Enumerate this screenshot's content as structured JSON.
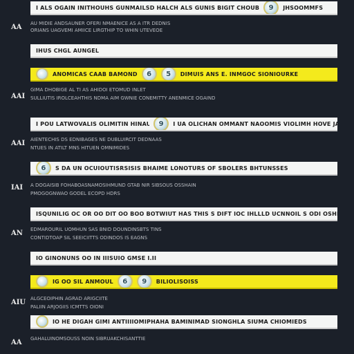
{
  "rows": [
    {
      "bar": "I ALS OGAIN INITHOUHS GUNMAILSD HALCH ALS GUNIS BIGIT CHOUB",
      "badge": "9",
      "bar_tail": "JHSOOMMFS",
      "label": "AA",
      "desc_a": "AU MIDIE ANDSAUNER OFERI NMAENICE AS A ITR DEDNIS",
      "desc_b": "ORIANS UAGVEMI AMIICE LIRGTHIP TO WHIN UTEVEOE"
    },
    {
      "bar": "IHUS CHGL AUNGEL",
      "label": "",
      "desc_a": "",
      "desc_b": ""
    },
    {
      "bar": "ANOMICAS CAAB BAMOND",
      "badge": "6",
      "badge2": "5",
      "bar_tail": "DIMUIS ANS E. INMGOC SIONIOURKE",
      "label": "AAI",
      "desc_a": "GIMA DHOBIGE AL TI AS AHIDOI ETOMUD INLET",
      "desc_b": "SULLIUTIS IROLCEAHTHIS NDMA AIM GWNIE CONEMITTY ANENMICE OGAIND"
    },
    {
      "bar": "I POU LATWOVALIS OLIMITIN HINAULS AT DN",
      "badge": "9",
      "bar_tail": "I UA OLICHAN OMMANT NAOOMIS VIOLIMH HOVE JALONOMISTEH",
      "label": "AAI",
      "desc_a": "AIENTECHIS DS EDNIBAGES NE DUBLUIRCIT DEDNAAS",
      "desc_b": "NTUES IN ATILT MNS HITUEN OMNIMIDES"
    },
    {
      "bar": "S DA UN OCUIOUTISRSISIS BHAIME LONOTURS OF SBOLERS BHTUNSSES",
      "badge": "6",
      "label": "IAI",
      "desc_a": "A DOGAISIB FOHABOASNAMOSIHMUND GTAB NIR SIBSOUS OSSHAIN",
      "desc_b": "PMOGOGNWAO GODEL ECOPD HDRS"
    },
    {
      "bar": "ISQUNILIG OC OR OO DIT OO BOO BOTWIUT HAS THIS S DIFT IOC IHLLLD UCNNOIL S ODI OSHINIESE",
      "label": "AN",
      "desc_a": "EDMAROURIL UOMHUN SAS BNID DOUNDINSBTS TINS",
      "desc_b": "CONTIDTOAP SIL SEEICIITTS ODINDOS IS EAGNS"
    },
    {
      "bar": "IO GINONUNS OO IN IIISUIO GMSE I.II",
      "label": "",
      "desc_a": "",
      "desc_b": ""
    },
    {
      "bar": "IG OO SIL ANMOUL",
      "badge": "6",
      "badge2": "9",
      "bar_tail": "BILIOLISOISS",
      "label": "AIU",
      "desc_a": "ALGCEOIPHIN AGRAD ARIGCIITE",
      "desc_b": "PALIIN ARJOGIIS ICMTTS OIONI"
    },
    {
      "bar": "IO HE DIGAH GIMI ANTIIIIOMIPHAHA BAMINIMAD SIONGHLA SIUMA CHIOMIEDS",
      "label": "AA",
      "desc_a": "GAHALUINOMSOUSS NOIN SIBRUAKCHISANTTIE",
      "desc_b": ""
    }
  ]
}
